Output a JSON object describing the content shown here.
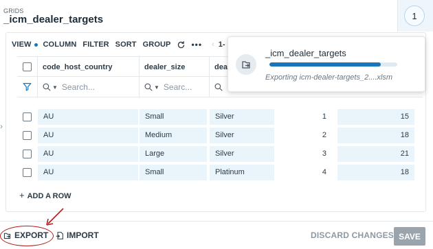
{
  "header": {
    "section_label": "GRIDS",
    "title": "_icm_dealer_targets",
    "badge_count": "1"
  },
  "toolbar": {
    "view": "VIEW",
    "column": "COLUMN",
    "filter": "FILTER",
    "sort": "SORT",
    "group": "GROUP",
    "more": "•••",
    "page": "1-"
  },
  "table": {
    "columns": [
      "code_host_country",
      "dealer_size",
      "dea"
    ],
    "search_placeholder": "Search...",
    "search_placeholder_short": "Searc...",
    "rows": [
      {
        "country": "AU",
        "size": "Small",
        "tier": "Silver",
        "idx": "1",
        "value": "15"
      },
      {
        "country": "AU",
        "size": "Medium",
        "tier": "Silver",
        "idx": "2",
        "value": "18"
      },
      {
        "country": "AU",
        "size": "Large",
        "tier": "Silver",
        "idx": "3",
        "value": "21"
      },
      {
        "country": "AU",
        "size": "Small",
        "tier": "Platinum",
        "idx": "4",
        "value": "18"
      }
    ],
    "add_row": "ADD A ROW"
  },
  "footer": {
    "export": "EXPORT",
    "import": "IMPORT",
    "discard": "DISCARD CHANGES",
    "save": "SAVE"
  },
  "toast": {
    "title": "_icm_dealer_targets",
    "message": "Exporting icm-dealer-targets_2....xlsm",
    "progress": 0.87
  },
  "colors": {
    "accent": "#1b75bb",
    "annotation": "#b01c1c",
    "cell_highlight": "#eaf4fb"
  }
}
